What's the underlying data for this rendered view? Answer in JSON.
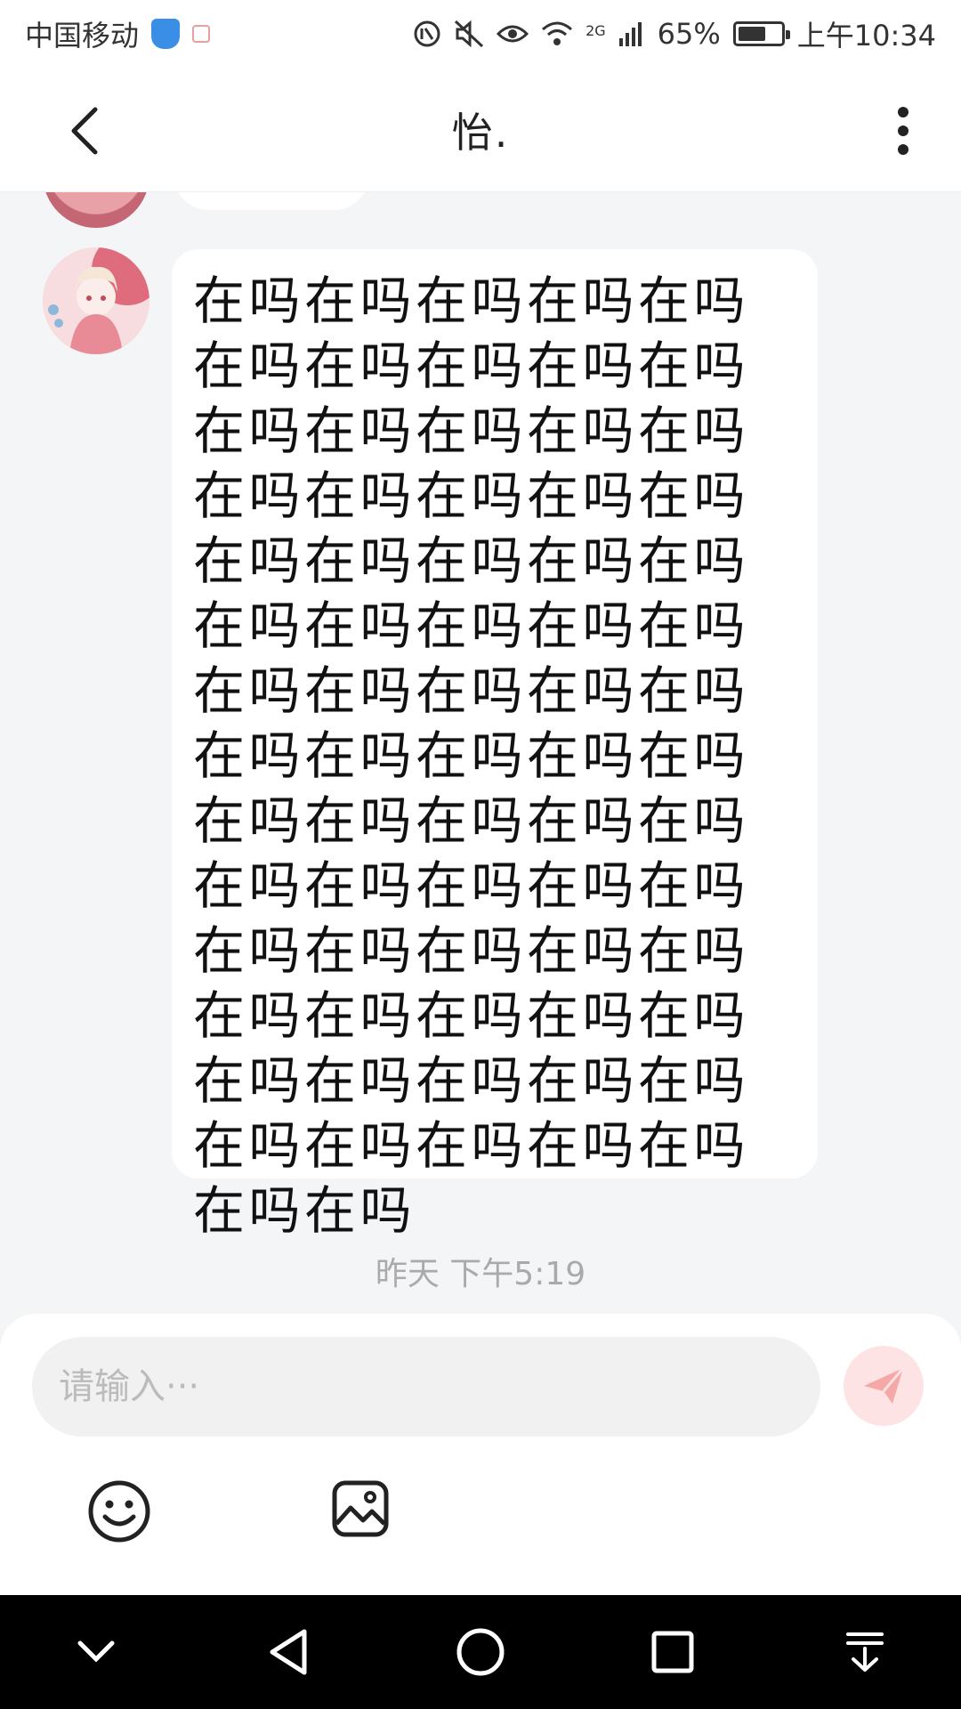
{
  "status_bar": {
    "carrier": "中国移动",
    "network": "2G",
    "battery": "65%",
    "time": "上午10:34",
    "battery_level": 0.65
  },
  "header": {
    "title": "怡."
  },
  "messages": [
    {
      "sender": "other",
      "text": "在吗在吗在吗在吗在吗在吗在吗在吗在吗在吗在吗在吗在吗在吗在吗在吗在吗在吗在吗在吗在吗在吗在吗在吗在吗在吗在吗在吗在吗在吗在吗在吗在吗在吗在吗在吗在吗在吗在吗在吗在吗在吗在吗在吗在吗在吗在吗在吗在吗在吗在吗在吗在吗在吗在吗在吗在吗在吗在吗在吗在吗在吗在吗在吗在吗在吗在吗在吗在吗在吗在吗在吗"
    }
  ],
  "timestamp": "昨天 下午5:19",
  "composer": {
    "placeholder": "请输入···"
  },
  "icons": {
    "back": "chevron-left-icon",
    "more": "more-vertical-icon",
    "send": "send-icon",
    "emoji": "emoji-icon",
    "image": "image-icon"
  },
  "colors": {
    "background": "#f4f5f7",
    "send_button": "#fde3e3",
    "send_arrow": "#f6a7a7",
    "timestamp": "#aaaaaa",
    "nav_bar": "#000000"
  }
}
